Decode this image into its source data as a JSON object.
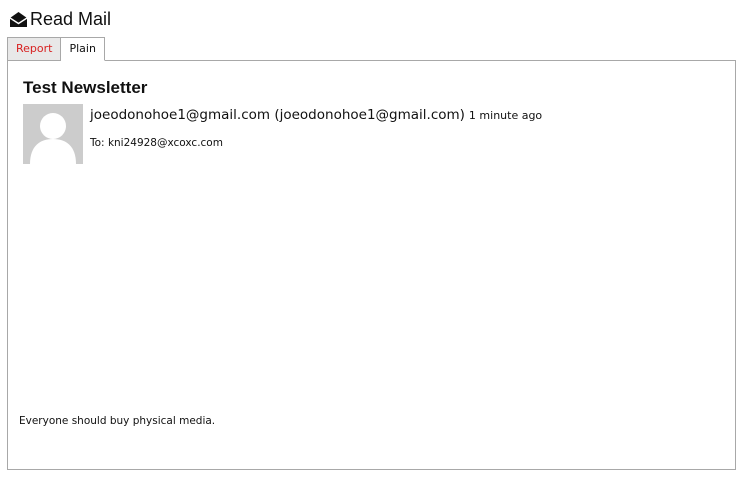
{
  "header": {
    "title": "Read Mail",
    "icon": "envelope-open-icon"
  },
  "tabs": [
    {
      "label": "Report",
      "active": false,
      "color": "#d82020"
    },
    {
      "label": "Plain",
      "active": true
    }
  ],
  "message": {
    "subject": "Test Newsletter",
    "sender": "joeodonohoe1@gmail.com (joeodonohoe1@gmail.com)",
    "time": "1 minute ago",
    "to_prefix": "To:",
    "to": "kni24928@xcoxc.com",
    "body": "Everyone should buy physical media.",
    "avatar": "default-avatar-icon"
  }
}
